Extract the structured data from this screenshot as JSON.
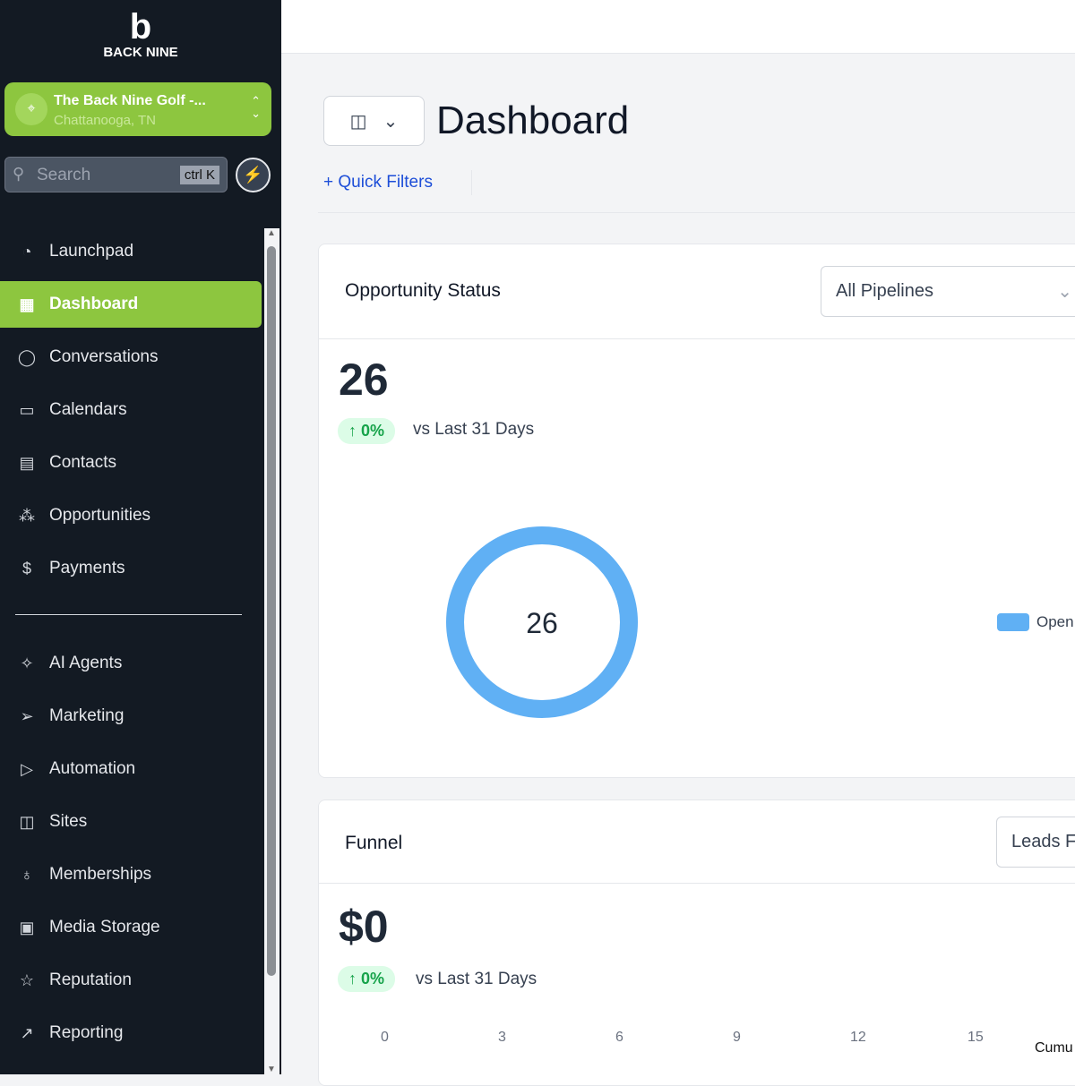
{
  "brand": {
    "logo_letter": "b",
    "name": "BACK NINE"
  },
  "location": {
    "name": "The Back Nine Golf -...",
    "city": "Chattanooga, TN"
  },
  "search": {
    "placeholder": "Search",
    "shortcut": "ctrl K"
  },
  "nav": [
    {
      "label": "Launchpad",
      "icon": "◔"
    },
    {
      "label": "Dashboard",
      "icon": "▦",
      "active": true
    },
    {
      "label": "Conversations",
      "icon": "◯"
    },
    {
      "label": "Calendars",
      "icon": "▭"
    },
    {
      "label": "Contacts",
      "icon": "▤"
    },
    {
      "label": "Opportunities",
      "icon": "⁂"
    },
    {
      "label": "Payments",
      "icon": "$"
    },
    {
      "label": "AI Agents",
      "icon": "✧"
    },
    {
      "label": "Marketing",
      "icon": "➢"
    },
    {
      "label": "Automation",
      "icon": "▷"
    },
    {
      "label": "Sites",
      "icon": "◫"
    },
    {
      "label": "Memberships",
      "icon": "♁"
    },
    {
      "label": "Media Storage",
      "icon": "▣"
    },
    {
      "label": "Reputation",
      "icon": "☆"
    },
    {
      "label": "Reporting",
      "icon": "↗"
    }
  ],
  "header": {
    "title": "Dashboard",
    "quick_filters": "+  Quick Filters"
  },
  "opportunity": {
    "title": "Opportunity Status",
    "pipeline": "All Pipelines",
    "value": "26",
    "change": "↑ 0%",
    "vs": "vs Last 31 Days",
    "donut_center": "26",
    "legend": "Open",
    "color": "#60b0f4",
    "open_count": 26
  },
  "funnel": {
    "title": "Funnel",
    "select": "Leads F",
    "value": "$0",
    "change": "↑ 0%",
    "vs": "vs Last 31 Days",
    "ticks": [
      "0",
      "3",
      "6",
      "9",
      "12",
      "15"
    ],
    "cumu_label": "Cumu"
  }
}
